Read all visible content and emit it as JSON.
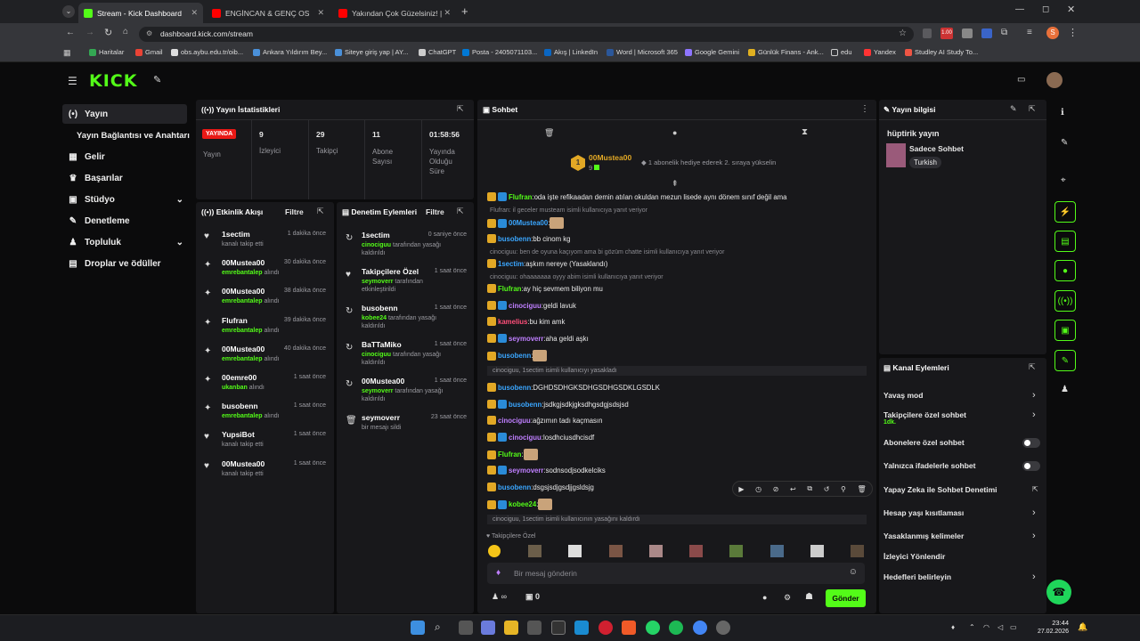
{
  "browser": {
    "tabs": [
      {
        "title": "Stream - Kick Dashboard",
        "color": "#53fc18"
      },
      {
        "title": "ENGİNCAN & GENÇ OSMA",
        "color": "#ff0000"
      },
      {
        "title": "Yakından Çok Güzelsiniz! | Mar",
        "color": "#ff0000"
      }
    ],
    "url": "dashboard.kick.com/stream",
    "profile_initial": "S",
    "bookmarks": [
      "Haritalar",
      "Gmail",
      "obs.aybu.edu.tr/oib...",
      "Ankara Yıldırım Bey...",
      "Siteye giriş yap | AY...",
      "ChatGPT",
      "Posta - 2405071103...",
      "Akış | LinkedIn",
      "Word | Microsoft 365",
      "Google Gemini",
      "Günlük Finans - Ank...",
      "edu",
      "Yandex",
      "Studley AI Study To..."
    ]
  },
  "site": {
    "logo": "KICK",
    "accent": "#53fc18"
  },
  "sidebar": {
    "items": [
      {
        "label": "Yayın",
        "icon": "(•)"
      },
      {
        "label": "Yayın Bağlantısı ve Anahtarı",
        "icon": ""
      },
      {
        "label": "Gelir",
        "icon": "▦"
      },
      {
        "label": "Başarılar",
        "icon": "♛"
      },
      {
        "label": "Stüdyo",
        "icon": "▣"
      },
      {
        "label": "Denetleme",
        "icon": "✎"
      },
      {
        "label": "Topluluk",
        "icon": "♟"
      },
      {
        "label": "Droplar ve ödüller",
        "icon": "▤"
      }
    ]
  },
  "stats": {
    "title": "Yayın İstatistikleri",
    "live_badge": "YAYINDA",
    "live_label": "Yayın",
    "items": [
      {
        "value": "9",
        "label": "İzleyici"
      },
      {
        "value": "29",
        "label": "Takipçi"
      },
      {
        "value": "11",
        "label": "Abone Sayısı"
      },
      {
        "value": "01:58:56",
        "label": "Yayında Olduğu Süre"
      }
    ]
  },
  "activity": {
    "title": "Etkinlik Akışı",
    "filter": "Filtre",
    "rows": [
      {
        "user": "1sectim",
        "desc": "kanalı takip etti",
        "by": "",
        "time": "1 dakika önce",
        "icon": "♥"
      },
      {
        "user": "00Mustea00",
        "desc": "alındı",
        "by": "emrebantalep",
        "time": "30 dakika önce",
        "icon": "✦"
      },
      {
        "user": "00Mustea00",
        "desc": "alındı",
        "by": "emrebantalep",
        "time": "38 dakika önce",
        "icon": "✦"
      },
      {
        "user": "Flufran",
        "desc": "alındı",
        "by": "emrebantalep",
        "time": "39 dakika önce",
        "icon": "✦"
      },
      {
        "user": "00Mustea00",
        "desc": "alındı",
        "by": "emrebantalep",
        "time": "40 dakika önce",
        "icon": "✦"
      },
      {
        "user": "00emre00",
        "desc": "alındı",
        "by": "ukanban",
        "time": "1 saat önce",
        "icon": "✦"
      },
      {
        "user": "busobenn",
        "desc": "alındı",
        "by": "emrebantalep",
        "time": "1 saat önce",
        "icon": "✦"
      },
      {
        "user": "YupsiBot",
        "desc": "kanalı takip etti",
        "by": "",
        "time": "1 saat önce",
        "icon": "♥"
      },
      {
        "user": "00Mustea00",
        "desc": "kanalı takip etti",
        "by": "",
        "time": "1 saat önce",
        "icon": "♥"
      }
    ]
  },
  "moderation": {
    "title": "Denetim Eylemleri",
    "filter": "Filtre",
    "rows": [
      {
        "user": "1sectim",
        "by": "cinociguu",
        "desc": "tarafından yasağı kaldırıldı",
        "time": "0 saniye önce",
        "icon": "↻"
      },
      {
        "user": "Takipçilere Özel",
        "by": "seymoverr",
        "desc": "tarafından etkinleştirildi",
        "time": "1 saat önce",
        "icon": "♥"
      },
      {
        "user": "busobenn",
        "by": "kobee24",
        "desc": "tarafından yasağı kaldırıldı",
        "time": "1 saat önce",
        "icon": "↻"
      },
      {
        "user": "BaTTaMiko",
        "by": "cinociguu",
        "desc": "tarafından yasağı kaldırıldı",
        "time": "1 saat önce",
        "icon": "↻"
      },
      {
        "user": "00Mustea00",
        "by": "seymoverr",
        "desc": "tarafından yasağı kaldırıldı",
        "time": "1 saat önce",
        "icon": "↻"
      },
      {
        "user": "seymoverr",
        "by": "",
        "desc": "bir mesajı sildi",
        "time": "23 saat önce",
        "icon": "🗑"
      }
    ]
  },
  "chat": {
    "title": "Sohbet",
    "pinned_user": "00Mustea00",
    "pinned_count": "9",
    "gift_text": "1 abonelik hediye ederek 2. sıraya yükselin",
    "lines": [
      {
        "user": "Flufran",
        "color": "#53fc18",
        "text": "oda işte refikaadan demin atılan okuldan mezun lisede aynı dönem sınıf değil ama",
        "type": "msg"
      },
      {
        "user": "",
        "color": "",
        "text": "Flufran: il geceler musteam isimli kullanıcıya yanıt veriyor",
        "type": "reply"
      },
      {
        "user": "00Mustea00",
        "color": "#3aa6ff",
        "text": "",
        "type": "msg"
      },
      {
        "user": "busobenn",
        "color": "#3aa6ff",
        "text": "bb cinom kg",
        "type": "msg"
      },
      {
        "user": "",
        "color": "",
        "text": "cinociguu: ben de oyuna kaçıyom ama bi gözüm chatte isimli kullanıcıya yanıt veriyor",
        "type": "reply"
      },
      {
        "user": "1sectim",
        "color": "#3aa6ff",
        "text": "aşkım nereye (Yasaklandı)",
        "type": "msg"
      },
      {
        "user": "",
        "color": "",
        "text": "cinociguu: ohaaaaaaa oyyy abim isimli kullanıcıya yanıt veriyor",
        "type": "reply"
      },
      {
        "user": "Flufran",
        "color": "#53fc18",
        "text": "ay hiç sevmem biliyon mu",
        "type": "msg"
      },
      {
        "user": "cinociguu",
        "color": "#bf7fff",
        "text": "geldi lavuk",
        "type": "msg"
      },
      {
        "user": "kamelius",
        "color": "#ff4f7a",
        "text": "bu kim amk",
        "type": "msg"
      },
      {
        "user": "seymoverr",
        "color": "#bf7fff",
        "text": "aha geldi aşkı",
        "type": "msg"
      },
      {
        "user": "busobenn",
        "color": "#3aa6ff",
        "text": "",
        "type": "msg"
      },
      {
        "user": "",
        "color": "",
        "text": "cinociguu, 1sectim isimli kullanıcıyı yasakladı",
        "type": "event"
      },
      {
        "user": "busobenn",
        "color": "#3aa6ff",
        "text": "DGHDSDHGKSDHGSDHGSDKLGSDLK",
        "type": "msg"
      },
      {
        "user": "busobenn",
        "color": "#3aa6ff",
        "text": "jsdkgjsdkjgksdhgsdgjsdsjsd",
        "type": "msg"
      },
      {
        "user": "cinociguu",
        "color": "#bf7fff",
        "text": "ağzımın tadı kaçmasın",
        "type": "msg"
      },
      {
        "user": "cinociguu",
        "color": "#bf7fff",
        "text": "losdhciusdhcisdf",
        "type": "msg"
      },
      {
        "user": "Flufran",
        "color": "#53fc18",
        "text": "",
        "type": "msg"
      },
      {
        "user": "seymoverr",
        "color": "#bf7fff",
        "text": "sodnsodjsodkelciks",
        "type": "msg"
      },
      {
        "user": "busobenn",
        "color": "#3aa6ff",
        "text": "dsgsjsdjgsdjjgsldsjg",
        "type": "msg"
      },
      {
        "user": "kobee24",
        "color": "#53fc18",
        "text": "",
        "type": "msg"
      },
      {
        "user": "",
        "color": "",
        "text": "cinociguu, 1sectim isimli kullanıcının yasağını kaldırdı",
        "type": "event"
      }
    ],
    "followers_only": "Takipçilere Özel",
    "input_placeholder": "Bir mesaj gönderin",
    "infinity": "∞",
    "gift_count": "0",
    "send": "Gönder"
  },
  "stream_info": {
    "title": "Yayın bilgisi",
    "stream_title": "hüptirik yayın",
    "category": "Sadece Sohbet",
    "language": "Turkish"
  },
  "channel_actions": {
    "title": "Kanal Eylemleri",
    "items": [
      {
        "label": "Yavaş mod",
        "sub": "",
        "control": "arrow"
      },
      {
        "label": "Takipçilere özel sohbet",
        "sub": "1dk.",
        "control": "arrow"
      },
      {
        "label": "Abonelere özel sohbet",
        "sub": "",
        "control": "toggle"
      },
      {
        "label": "Yalnızca ifadelerle sohbet",
        "sub": "",
        "control": "toggle"
      },
      {
        "label": "Yapay Zeka ile Sohbet Denetimi",
        "sub": "",
        "control": "external"
      },
      {
        "label": "Hesap yaşı kısıtlaması",
        "sub": "",
        "control": "arrow"
      },
      {
        "label": "Yasaklanmış kelimeler",
        "sub": "",
        "control": "arrow"
      },
      {
        "label": "İzleyici Yönlendir",
        "sub": "",
        "control": "none"
      },
      {
        "label": "Hedefleri belirleyin",
        "sub": "",
        "control": "arrow"
      }
    ]
  },
  "taskbar": {
    "time": "23:44",
    "date": "27.02.2026"
  }
}
